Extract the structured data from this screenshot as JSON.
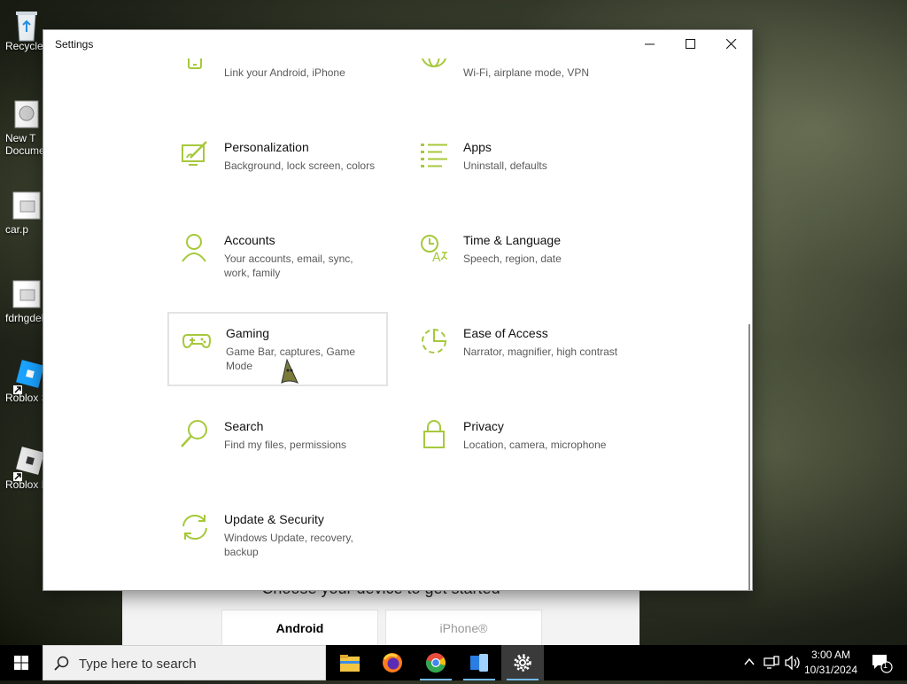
{
  "desktop": {
    "icons": [
      {
        "label": "Recycle",
        "icon": "recycle-bin-icon"
      },
      {
        "label": "New T",
        "label2": "Docume",
        "icon": "text-document-icon"
      },
      {
        "label": "car.p",
        "icon": "image-file-icon"
      },
      {
        "label": "fdrhgdel",
        "icon": "image-file-icon"
      },
      {
        "label": "Roblox S",
        "icon": "roblox-studio-icon"
      },
      {
        "label": "Roblox P",
        "icon": "roblox-player-icon"
      }
    ]
  },
  "background_window": {
    "heading": "Choose your device to get started",
    "buttons": [
      "Android",
      "iPhone®"
    ]
  },
  "settings_window": {
    "title": "Settings",
    "accent_color": "#a6c93b",
    "tiles": [
      {
        "name": "",
        "desc": "Link your Android, iPhone",
        "icon": "phone-icon"
      },
      {
        "name": "",
        "desc": "Wi-Fi, airplane mode, VPN",
        "icon": "globe-icon"
      },
      {
        "name": "Personalization",
        "desc": "Background, lock screen, colors",
        "icon": "personalization-icon"
      },
      {
        "name": "Apps",
        "desc": "Uninstall, defaults",
        "icon": "apps-list-icon"
      },
      {
        "name": "Accounts",
        "desc": "Your accounts, email, sync, work, family",
        "icon": "person-icon"
      },
      {
        "name": "Time & Language",
        "desc": "Speech, region, date",
        "icon": "time-language-icon"
      },
      {
        "name": "Gaming",
        "desc": "Game Bar, captures, Game Mode",
        "icon": "gamepad-icon"
      },
      {
        "name": "Ease of Access",
        "desc": "Narrator, magnifier, high contrast",
        "icon": "ease-of-access-icon"
      },
      {
        "name": "Search",
        "desc": "Find my files, permissions",
        "icon": "search-icon"
      },
      {
        "name": "Privacy",
        "desc": "Location, camera, microphone",
        "icon": "lock-icon"
      },
      {
        "name": "Update & Security",
        "desc": "Windows Update, recovery, backup",
        "icon": "sync-icon"
      }
    ]
  },
  "taskbar": {
    "search_placeholder": "Type here to search",
    "apps": [
      "file-explorer-icon",
      "firefox-icon",
      "chrome-icon",
      "phone-link-icon",
      "settings-gear-icon"
    ],
    "time": "3:00 AM",
    "date": "10/31/2024",
    "notification_count": "1"
  }
}
